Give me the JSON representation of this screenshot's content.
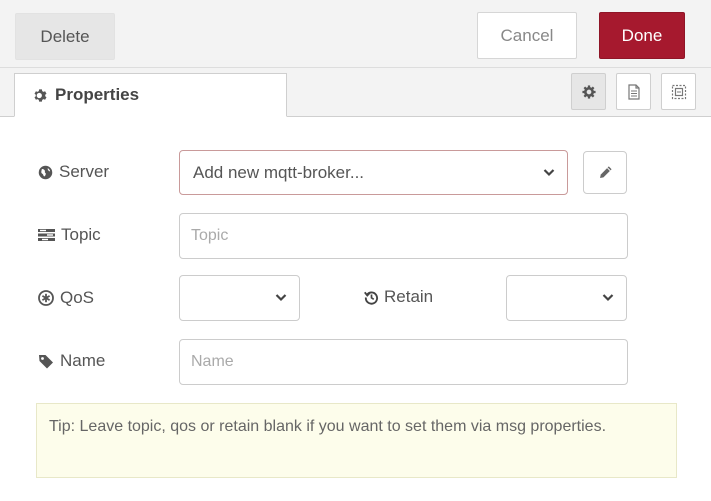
{
  "toolbar": {
    "delete_label": "Delete",
    "cancel_label": "Cancel",
    "done_label": "Done"
  },
  "tabs": {
    "properties_label": "Properties",
    "icons": [
      "gear-icon",
      "document-icon",
      "layout-icon"
    ]
  },
  "form": {
    "server": {
      "label": "Server",
      "value": "Add new mqtt-broker..."
    },
    "topic": {
      "label": "Topic",
      "placeholder": "Topic",
      "value": ""
    },
    "qos": {
      "label": "QoS",
      "value": ""
    },
    "retain": {
      "label": "Retain",
      "value": ""
    },
    "name": {
      "label": "Name",
      "placeholder": "Name",
      "value": ""
    }
  },
  "tip": "Tip: Leave topic, qos or retain blank if you want to set them via msg properties.",
  "colors": {
    "done_bg": "#a6192e",
    "toolbar_bg": "#f3f3f3",
    "tip_bg": "#fdfdeb"
  }
}
